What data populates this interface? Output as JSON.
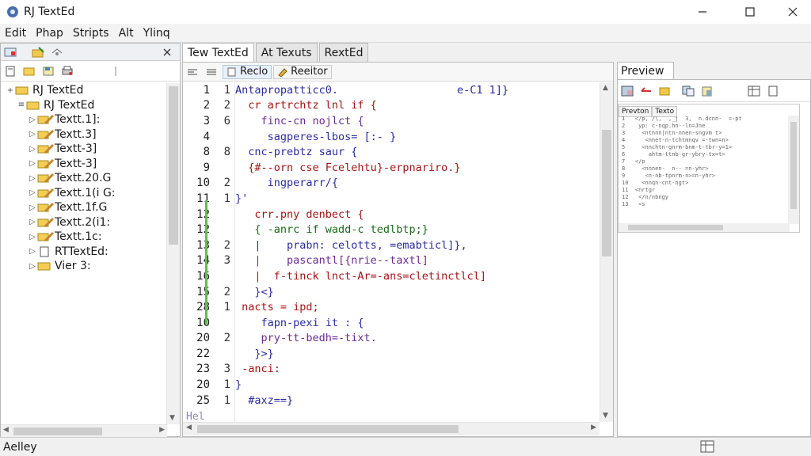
{
  "window": {
    "title": "RJ TextEd"
  },
  "menu": [
    "Edit",
    "Phap",
    "Stripts",
    "Alt",
    "Ylinq"
  ],
  "left_panel": {
    "tree": [
      {
        "label": "RJ TextEd",
        "level": 0,
        "exp": "+",
        "icon": "folder"
      },
      {
        "label": "RJ TextEd",
        "level": 1,
        "exp": "-",
        "icon": "folder"
      },
      {
        "label": "Textt.1]:",
        "level": 2,
        "exp": "+",
        "icon": "folder-pencil"
      },
      {
        "label": "Textt.3]",
        "level": 2,
        "exp": "+",
        "icon": "folder-pencil"
      },
      {
        "label": "Textt-3]",
        "level": 2,
        "exp": "+",
        "icon": "folder-pencil"
      },
      {
        "label": "Textt-3]",
        "level": 2,
        "exp": "+",
        "icon": "folder-pencil"
      },
      {
        "label": "Textt.20.G",
        "level": 2,
        "exp": "+",
        "icon": "folder-pencil"
      },
      {
        "label": "Textt.1(i G:",
        "level": 2,
        "exp": "+",
        "icon": "folder-pencil"
      },
      {
        "label": "Textt.1f.G",
        "level": 2,
        "exp": "+",
        "icon": "folder-pencil"
      },
      {
        "label": "Textt.2(i1:",
        "level": 2,
        "exp": "+",
        "icon": "folder-pencil"
      },
      {
        "label": "Textt.1c:",
        "level": 2,
        "exp": "+",
        "icon": "folder-pencil"
      },
      {
        "label": "RTTextEd:",
        "level": 2,
        "exp": "+",
        "icon": "file"
      },
      {
        "label": "Vier 3:",
        "level": 2,
        "exp": "+",
        "icon": "folder"
      }
    ]
  },
  "tabs": [
    {
      "label": "Tew TextEd",
      "active": true
    },
    {
      "label": "At Texuts",
      "active": false
    },
    {
      "label": "RextEd",
      "active": false
    }
  ],
  "editor": {
    "toolbar": {
      "btn1": "Reclo",
      "btn2": "Reeitor"
    },
    "line_numbers": [
      "1",
      "2",
      "3",
      "4",
      "8",
      "9",
      "10",
      "11",
      "12",
      "12",
      "13",
      "14",
      "16",
      "15",
      "28",
      "10",
      "20",
      "22",
      "23",
      "20",
      "25"
    ],
    "fold_numbers": [
      "1",
      "2",
      "6",
      "",
      "8",
      "",
      "2",
      "1",
      "",
      "",
      "2",
      "3",
      "",
      "2",
      "1",
      "",
      "2",
      "",
      "3",
      "1",
      "1"
    ],
    "lines": [
      {
        "text": "Antapropatticc0.",
        "right": "e-C1 1]}",
        "c": "k1"
      },
      {
        "text": "  cr artrchtz lnl if {",
        "c": "k2"
      },
      {
        "text": "    finc-cn nojlct {",
        "c": "k3"
      },
      {
        "text": "     sagperes-lbos= [:- }",
        "c": "k1"
      },
      {
        "text": "  cnc-prebtz saur {",
        "c": "k1"
      },
      {
        "text": "  {#--orn cse Fcelehtu}-erpnariro.}",
        "c": "k2"
      },
      {
        "text": "     ingperarr/{",
        "c": "k1"
      },
      {
        "text": "}'",
        "c": "k1"
      },
      {
        "text": "   crr.pny denbect {",
        "c": "k2"
      },
      {
        "text": "   { -anrc if wadd-c tedlbtp;}",
        "c": "k4"
      },
      {
        "text": "   |    prabn: celotts, =emabticl]},",
        "c": "k1"
      },
      {
        "text": "   |    pascantl[{nrie--taxtl]",
        "c": "k3"
      },
      {
        "text": "   |  f-tinck lnct-Ar=-ans=cletinctlcl]",
        "c": "k2"
      },
      {
        "text": "   }<}",
        "c": "k1"
      },
      {
        "text": " nacts = ipd;",
        "c": "k2"
      },
      {
        "text": "    fapn-pexi it : {",
        "c": "k1"
      },
      {
        "text": "    pry-tt-bedh=-tixt.",
        "c": "k3"
      },
      {
        "text": "   }>}",
        "c": "k1"
      },
      {
        "text": " -anci:",
        "c": "k2"
      },
      {
        "text": "}",
        "c": "k1"
      },
      {
        "text": "  #axz==}",
        "c": "k1"
      }
    ],
    "partial_line": "Hel"
  },
  "preview": {
    "tab_label": "Preview",
    "inner_tabs": [
      "Prevton",
      "Texto"
    ],
    "mini_lines": [
      "1   </p, /\\,  ,_j  3,  n.dcnn-  =-pt",
      "2    yp: c-nqp.hn--ln=Jne",
      "3     <ntnnn|ntn-nnen-sngvm t>",
      "4      <nnet-n-tchtmnqv =-twn=n>",
      "5     <nnchtn-gnrm-bnm-t-tbr-y=1>",
      "6       ahtm-ttnb-gr-ybry-tx=t>",
      "7   </p",
      "8     <nnnen-  n-- =n-yhr>",
      "9      <n-nb-tpnrm-n>=n-yhr>",
      "10    <nnqn-cnt-ngt>",
      "11  <nrtgr",
      "12   </n/nbngy",
      "13   <s"
    ]
  },
  "status": {
    "text": "Aelley"
  }
}
